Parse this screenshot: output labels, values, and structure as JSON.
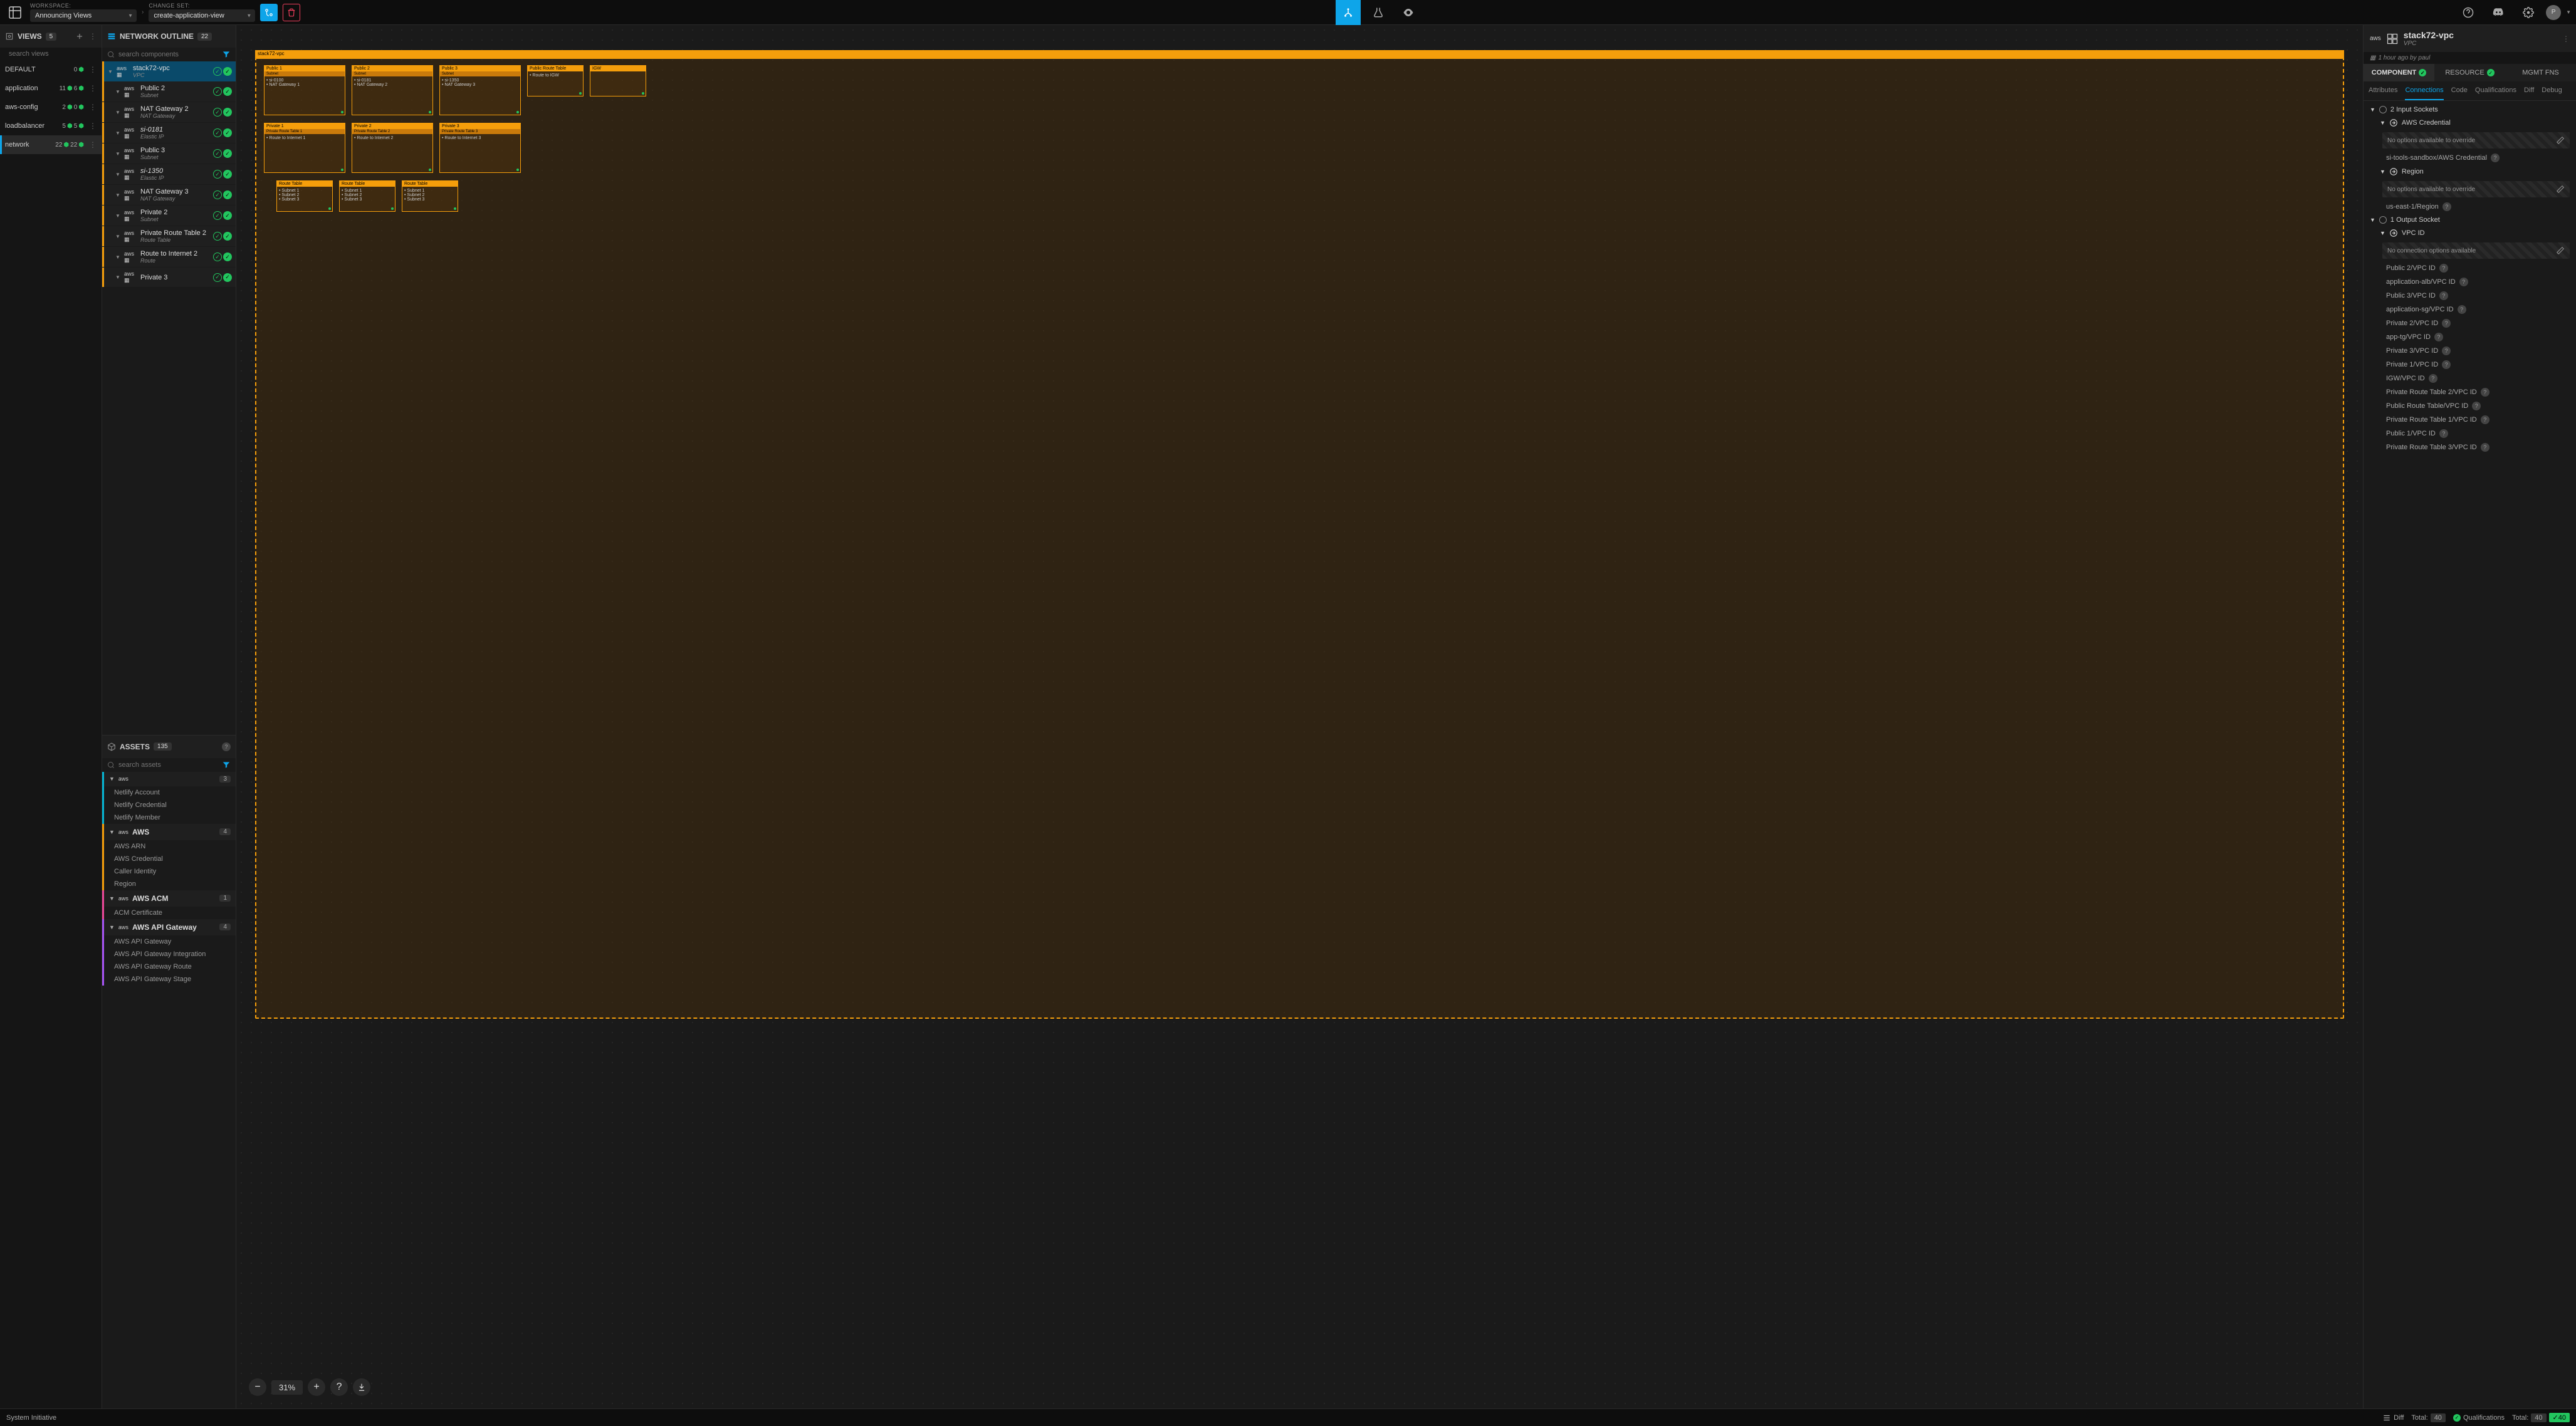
{
  "topbar": {
    "workspace_label": "WORKSPACE:",
    "workspace_value": "Announcing Views",
    "changeset_label": "CHANGE SET:",
    "changeset_value": "create-application-view",
    "avatar_letter": "P"
  },
  "views": {
    "title": "VIEWS",
    "count": "5",
    "search_placeholder": "search views",
    "items": [
      {
        "name": "DEFAULT",
        "left": "0",
        "selected": false
      },
      {
        "name": "application",
        "left": "11",
        "right": "6",
        "selected": false
      },
      {
        "name": "aws-config",
        "left": "2",
        "right": "0",
        "selected": false
      },
      {
        "name": "loadbalancer",
        "left": "5",
        "right": "5",
        "selected": false
      },
      {
        "name": "network",
        "left": "22",
        "right": "22",
        "selected": true
      }
    ]
  },
  "outline": {
    "title": "NETWORK OUTLINE",
    "count": "22",
    "search_placeholder": "search components",
    "items": [
      {
        "title": "stack72-vpc",
        "sub": "VPC",
        "selected": true,
        "icon": "aws"
      },
      {
        "title": "Public 2",
        "sub": "Subnet",
        "icon": "aws"
      },
      {
        "title": "NAT Gateway 2",
        "sub": "NAT Gateway",
        "icon": "aws"
      },
      {
        "title": "si-0181",
        "sub": "Elastic IP",
        "icon": "aws",
        "italic": true
      },
      {
        "title": "Public 3",
        "sub": "Subnet",
        "icon": "aws"
      },
      {
        "title": "si-1350",
        "sub": "Elastic IP",
        "icon": "aws",
        "italic": true
      },
      {
        "title": "NAT Gateway 3",
        "sub": "NAT Gateway",
        "icon": "aws"
      },
      {
        "title": "Private 2",
        "sub": "Subnet",
        "icon": "aws"
      },
      {
        "title": "Private Route Table 2",
        "sub": "Route Table",
        "icon": "aws"
      },
      {
        "title": "Route to Internet 2",
        "sub": "Route",
        "icon": "aws"
      },
      {
        "title": "Private 3",
        "sub": "",
        "icon": "aws"
      }
    ]
  },
  "assets": {
    "title": "ASSETS",
    "count": "135",
    "search_placeholder": "search assets",
    "groups": [
      {
        "name": "",
        "count": "3",
        "color": "cyan",
        "subs": [
          "Netlify Account",
          "Netlify Credential",
          "Netlify Member"
        ]
      },
      {
        "name": "AWS",
        "count": "4",
        "color": "orange",
        "subs": [
          "AWS ARN",
          "AWS Credential",
          "Caller Identity",
          "Region"
        ]
      },
      {
        "name": "AWS ACM",
        "count": "1",
        "color": "pink",
        "subs": [
          "ACM Certificate"
        ]
      },
      {
        "name": "AWS API Gateway",
        "count": "4",
        "color": "purple",
        "subs": [
          "AWS API Gateway",
          "AWS API Gateway Integration",
          "AWS API Gateway Route",
          "AWS API Gateway Stage"
        ]
      }
    ]
  },
  "canvas": {
    "zoom": "31%",
    "vpc_title": "stack72-vpc"
  },
  "detail": {
    "title": "stack72-vpc",
    "sub": "VPC",
    "meta": "1 hour ago by paul",
    "tabs_top": [
      "COMPONENT",
      "RESOURCE",
      "MGMT FNS"
    ],
    "tabs_sub": [
      "Attributes",
      "Connections",
      "Code",
      "Qualifications",
      "Diff",
      "Debug"
    ],
    "input_header": "2 Input Sockets",
    "aws_cred": "AWS Credential",
    "no_opts": "No options available to override",
    "aws_cred_val": "si-tools-sandbox/AWS Credential",
    "region": "Region",
    "region_val": "us-east-1/Region",
    "output_header": "1 Output Socket",
    "vpc_id": "VPC ID",
    "no_conn": "No connection options available",
    "connections": [
      "Public 2/VPC ID",
      "application-alb/VPC ID",
      "Public 3/VPC ID",
      "application-sg/VPC ID",
      "Private 2/VPC ID",
      "app-tg/VPC ID",
      "Private 3/VPC ID",
      "Private 1/VPC ID",
      "IGW/VPC ID",
      "Private Route Table 2/VPC ID",
      "Public Route Table/VPC ID",
      "Private Route Table 1/VPC ID",
      "Public 1/VPC ID",
      "Private Route Table 3/VPC ID"
    ]
  },
  "statusbar": {
    "product": "System Initiative",
    "diff": "Diff",
    "total_label": "Total: ",
    "total_val": "40",
    "qual": "Qualifications",
    "qual_val": "40"
  }
}
